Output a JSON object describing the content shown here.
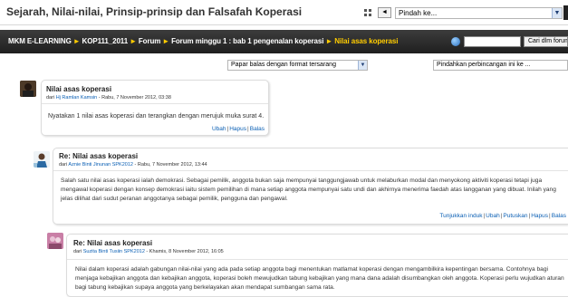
{
  "header": {
    "title": "Sejarah, Nilai-nilai, Prinsip-prinsip dan Falsafah Koperasi",
    "nav_prev": "◄",
    "jump_label": "Pindah ke...",
    "jump_arrow": "▼"
  },
  "breadcrumb": {
    "items": [
      "MKM E-LEARNING",
      "KOP111_2011",
      "Forum",
      "Forum minggu 1 : bab 1 pengenalan koperasi"
    ],
    "current": "Nilai asas koperasi",
    "separator": "►"
  },
  "search": {
    "placeholder": "",
    "button_label": "Cari dlm forum"
  },
  "controls": {
    "display_mode": "Papar balas dengan format tersarang",
    "move_discussion": "Pindahkan perbincangan ini ke ...",
    "arrow": "▼"
  },
  "posts": [
    {
      "subject": "Nilai asas koperasi",
      "meta_prefix": "dari ",
      "author": "Hj Ramlan Kamsin",
      "meta_date": " - Rabu, 7 November 2012, 03:38",
      "body": "Nyatakan 1 nilai asas koperasi dan terangkan dengan merujuk muka surat 4.",
      "actions": [
        "Ubah",
        "Hapus",
        "Balas"
      ]
    },
    {
      "subject": "Re: Nilai asas koperasi",
      "meta_prefix": "dari ",
      "author": "Aznie Binti Jinunan SPK2012",
      "meta_date": " - Rabu, 7 November 2012, 13:44",
      "body": "Salah satu nilai asas koperasi ialah demokrasi. Sebagai pemilik, anggota bukan saja mempunyai tanggungjawab untuk melaburkan modal dan menyokong aktiviti koperasi tetapi juga mengawal koperasi dengan konsep demokrasi iaitu sistem pemilihan di mana setiap anggota mempunyai satu undi dan akhirnya menerima faedah atas langganan yang dibuat. Inilah yang jelas dilihat dari sudut peranan anggotanya sebagai pemilik, pengguna dan pengawal.",
      "actions": [
        "Tunjukkan induk",
        "Ubah",
        "Putuskan",
        "Hapus",
        "Balas"
      ]
    },
    {
      "subject": "Re: Nilai asas koperasi",
      "meta_prefix": "dari ",
      "author": "Suzita Binti Tusiin SPK2012",
      "meta_date": " - Khamis, 8 November 2012, 16:05",
      "body": "Nilai dalam koperasi adalah gabungan nilai-nilai yang ada pada setiap anggota bagi menentukan matlamat koperasi dengan mengambilkira kepentingan bersama. Contohnya bagi menjaga kebajikan anggota dan kebajikan anggota, koperasi boleh mewujudkan tabung kebajikan yang mana dana adalah disumbangkan oleh anggota. Koperasi perlu wujudkan aturan bagi tabung kebajikan supaya anggota yang berkelayakan akan mendapat sumbangan sama rata."
    }
  ]
}
